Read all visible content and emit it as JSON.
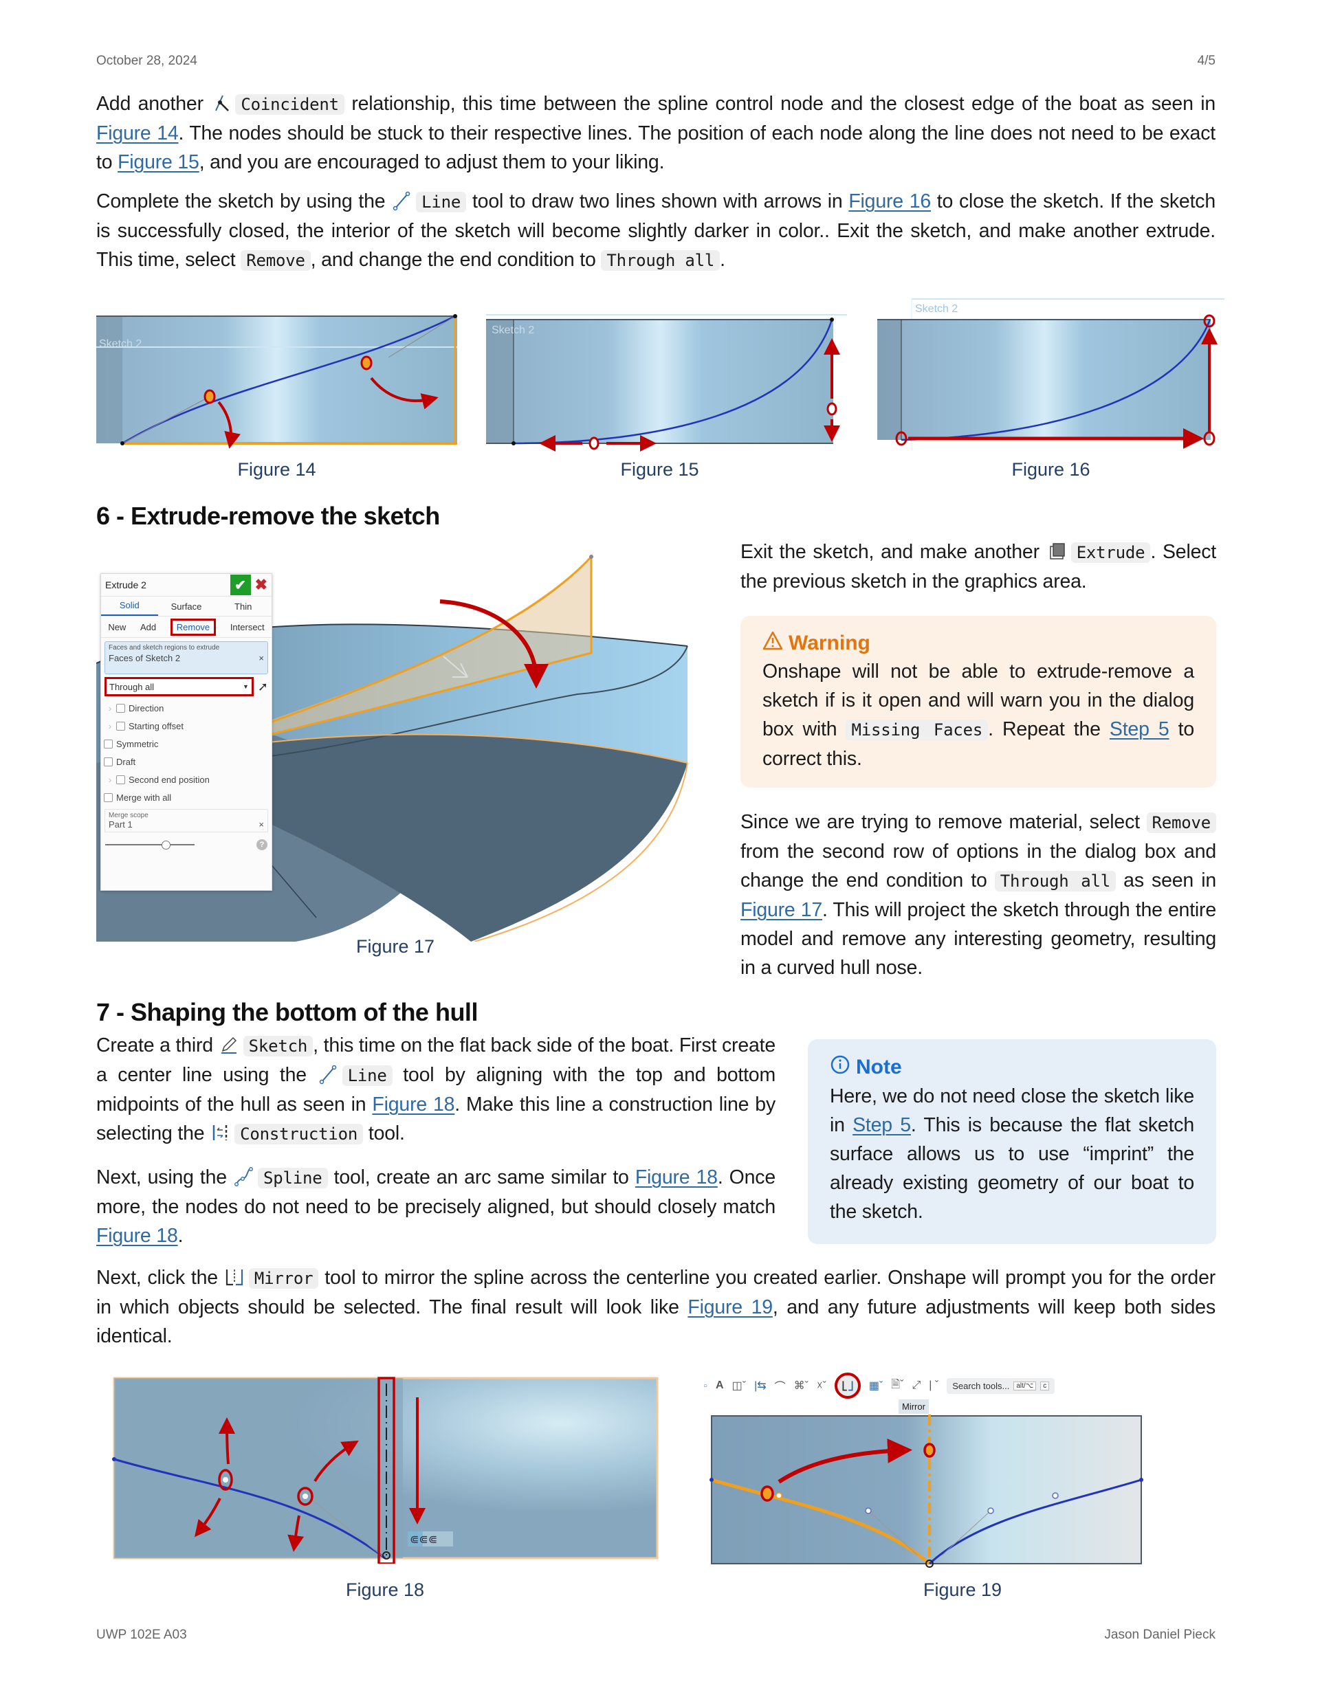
{
  "header": {
    "date": "October 28, 2024",
    "page": "4/5"
  },
  "footer": {
    "course": "UWP 102E A03",
    "author": "Jason Daniel Pieck"
  },
  "intro": {
    "p1": {
      "t1": "Add another ",
      "tool": "Coincident",
      "t2": " relationship, this time between the spline control node and the closest edge of the boat as seen in ",
      "link1": "Figure 14",
      "t3": ". The nodes should be stuck to their respective lines. The position of each node along the line does not need to be exact to ",
      "link2": "Figure 15",
      "t4": ", and you are encouraged to adjust them to your liking."
    },
    "p2": {
      "t1": "Complete the sketch by using the ",
      "tool": "Line",
      "t2": " tool to draw two lines shown with arrows in ",
      "link1": "Figure 16",
      "t3": " to close the sketch. If the sketch is successfully closed, the interior of the sketch will become slightly darker in color.. Exit the sketch, and make another extrude. This time, select ",
      "code1": "Remove",
      "t4": ", and change the end condition to ",
      "code2": "Through all",
      "t5": "."
    }
  },
  "figures_row1": [
    {
      "caption": "Figure 14",
      "sketch_label": "Sketch 2"
    },
    {
      "caption": "Figure 15",
      "sketch_label": "Sketch 2"
    },
    {
      "caption": "Figure 16",
      "sketch_label": "Sketch 2"
    }
  ],
  "section6": {
    "title": "6 - Extrude-remove the sketch",
    "p1": {
      "t1": "Exit the sketch, and make another ",
      "tool": "Extrude",
      "t2": ". Select the previous sketch in the graphics area."
    },
    "warning": {
      "title": "Warning",
      "t1": "Onshape will not be able to extrude-remove a sketch if is it open and will warn you in the dialog box with ",
      "code": "Missing Faces",
      "t2": ". Repeat the ",
      "link": "Step 5",
      "t3": " to correct this."
    },
    "p2": {
      "t1": "Since we are trying to remove material, select ",
      "code1": "Remove",
      "t2": " from the second row of options in the dialog box and change the end condition to ",
      "code2": "Through all",
      "t3": " as seen in ",
      "link": "Figure 17",
      "t4": ". This will project the sketch through the entire model and remove any interesting geometry, resulting in a curved hull nose."
    },
    "figure17": {
      "caption": "Figure 17",
      "dialog": {
        "title": "Extrude 2",
        "tabs": [
          "Solid",
          "Surface",
          "Thin"
        ],
        "active_tab": "Solid",
        "ops": [
          "New",
          "Add",
          "Remove",
          "Intersect"
        ],
        "active_op": "Remove",
        "faces_label": "Faces and sketch regions to extrude",
        "faces_value": "Faces of Sketch 2",
        "end_condition": "Through all",
        "options": [
          {
            "label": "Direction",
            "expandable": true,
            "checked": false
          },
          {
            "label": "Starting offset",
            "expandable": true,
            "checked": false
          },
          {
            "label": "Symmetric",
            "expandable": false,
            "checked": false
          },
          {
            "label": "Draft",
            "expandable": false,
            "checked": false
          },
          {
            "label": "Second end position",
            "expandable": true,
            "checked": false
          },
          {
            "label": "Merge with all",
            "expandable": false,
            "checked": false
          }
        ],
        "merge_scope_label": "Merge scope",
        "merge_scope_value": "Part 1",
        "help": "?"
      }
    }
  },
  "section7": {
    "title": "7 - Shaping the bottom of the hull",
    "p1": {
      "t1": "Create a third ",
      "tool1": "Sketch",
      "t2": ", this time on the flat back side of the boat. First create a center line using the ",
      "tool2": "Line",
      "t3": " tool by aligning with the top and bottom midpoints of the hull as seen in ",
      "link": "Figure 18",
      "t4": ". Make this line a construction line by selecting the ",
      "tool3": "Construction",
      "t5": " tool."
    },
    "p2": {
      "t1": "Next, using the ",
      "tool": "Spline",
      "t2": " tool, create an arc same similar to ",
      "link1": "Figure 18",
      "t3": ". Once more, the nodes do not need to be precisely aligned, but should closely match ",
      "link2": "Figure 18",
      "t4": "."
    },
    "note": {
      "title": "Note",
      "t1": "Here, we do not need close the sketch like in ",
      "link": "Step 5",
      "t2": ". This is because the flat sketch surface allows us to use “imprint” the already existing geometry of our boat to the sketch."
    },
    "p3": {
      "t1": "Next, click the ",
      "tool": "Mirror",
      "t2": " tool to mirror the spline across the centerline you created earlier. Onshape will prompt you for the order in which objects should be selected. The final result will look like ",
      "link": "Figure 19",
      "t3": ", and any future adjustments will keep both sides identical."
    },
    "figure18": {
      "caption": "Figure 18"
    },
    "figure19": {
      "caption": "Figure 19",
      "toolbar": {
        "tooltip": "Mirror",
        "search_placeholder": "Search tools...",
        "shortcut1": "alt/⌥",
        "shortcut2": "c"
      }
    }
  },
  "colors": {
    "link": "#2f6aa3",
    "warning": "#e07512",
    "note": "#1a6ed1",
    "annotation_red": "#c00000",
    "sketch_blue": "#2233bb",
    "highlight_orange": "#f0a020"
  }
}
